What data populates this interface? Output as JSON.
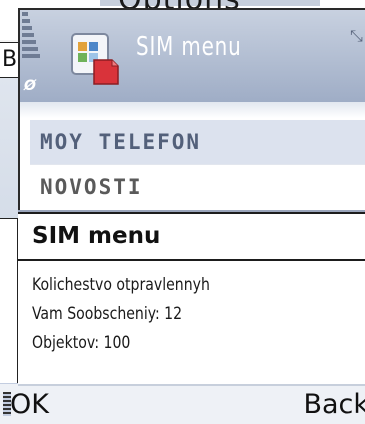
{
  "background": {
    "title": "Options",
    "back_fragment": "Ba"
  },
  "window": {
    "title": "SIM menu",
    "icons": {
      "signal": "signal-strength-icon",
      "antenna": "antenna-icon",
      "app": "sim-application-icon",
      "resize": "resize-icon"
    }
  },
  "menu": {
    "items": [
      {
        "label": "MOY TELEFON",
        "selected": true
      },
      {
        "label": "NOVOSTI",
        "selected": false
      }
    ]
  },
  "popup": {
    "title": "SIM menu",
    "lines": [
      "Kolichestvo otpravlennyh",
      "Vam Soobscheniy: 12",
      "Objektov: 100"
    ]
  },
  "softkeys": {
    "left": "OK",
    "right": "Back"
  },
  "colors": {
    "titlebar_accent": "#9fadc6",
    "selection": "#dce2ee",
    "text": "#111111"
  }
}
